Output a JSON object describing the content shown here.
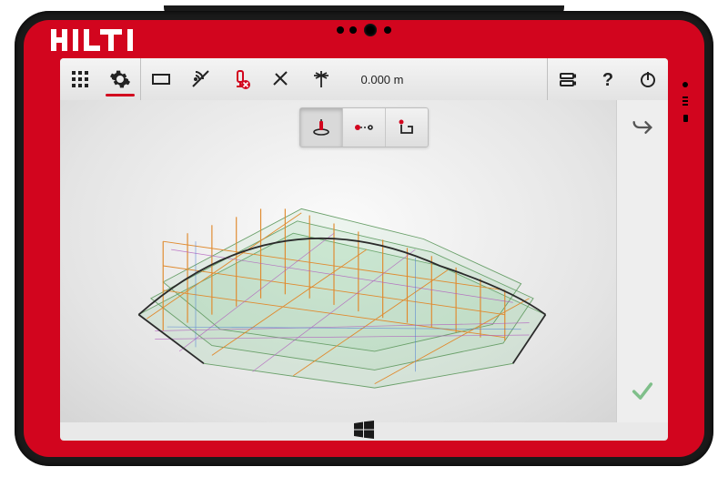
{
  "brand": {
    "name": "HILTI",
    "logo_color": "#ffffff"
  },
  "colors": {
    "accent": "#d2051e",
    "icon": "#222222",
    "confirm": "#56b76f"
  },
  "toolbar": {
    "apps_label": "apps-grid",
    "settings_label": "settings",
    "view_label": "view-rectangle",
    "satellite_label": "satellite-disabled",
    "instrument_label": "instrument-disconnected",
    "laser_label": "laser-off",
    "prism_label": "prism",
    "measurement_value": "0.000 m",
    "battery_label": "battery",
    "help_label": "help",
    "power_label": "power"
  },
  "modebar": {
    "station_label": "station-setup",
    "line_label": "two-point-line",
    "layout_label": "layout-corner"
  },
  "actions": {
    "undo_label": "undo",
    "confirm_label": "confirm"
  },
  "os": {
    "windows_label": "windows"
  },
  "model": {
    "description": "3D BIM structural model isometric view"
  }
}
